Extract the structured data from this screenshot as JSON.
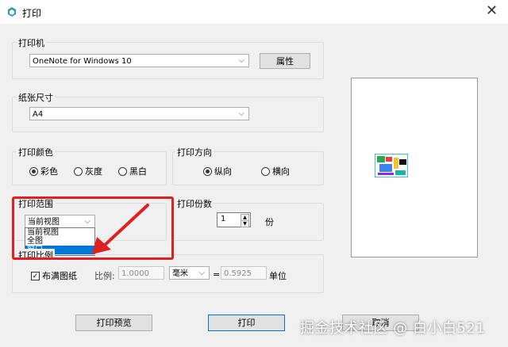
{
  "window": {
    "title": "打印",
    "close_glyph": "✕"
  },
  "printer": {
    "group_label": "打印机",
    "selected": "OneNote for Windows 10",
    "properties_button": "属性"
  },
  "paper": {
    "group_label": "纸张尺寸",
    "selected": "A4"
  },
  "color": {
    "group_label": "打印颜色",
    "options": [
      {
        "label": "彩色",
        "checked": true
      },
      {
        "label": "灰度",
        "checked": false
      },
      {
        "label": "黑白",
        "checked": false
      }
    ]
  },
  "orientation": {
    "group_label": "打印方向",
    "options": [
      {
        "label": "纵向",
        "checked": true
      },
      {
        "label": "横向",
        "checked": false
      }
    ]
  },
  "range": {
    "group_label": "打印范围",
    "selected": "当前视图",
    "options": [
      "当前视图",
      "全图",
      "窗口"
    ],
    "highlighted": "窗口"
  },
  "copies": {
    "group_label": "打印份数",
    "value": "1",
    "unit": "份"
  },
  "scale": {
    "group_label": "打印比例",
    "fit_label": "布满图纸",
    "fit_checked": true,
    "ratio_label": "比例:",
    "ratio_value": "1.0000",
    "unit_selected": "毫米",
    "equals": "=",
    "result_value": "0.5925",
    "unit_label": "单位"
  },
  "buttons": {
    "preview": "打印预览",
    "print": "打印",
    "cancel": "取消"
  },
  "watermark": "掘金技术社区 @ 白小白521",
  "colors": {
    "accent": "#0078d7",
    "annotation": "#e02020"
  }
}
